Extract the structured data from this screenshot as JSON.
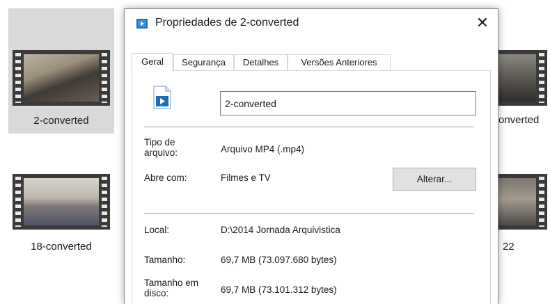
{
  "explorer": {
    "items": [
      {
        "label": "2-converted",
        "selected": true
      },
      {
        "label": "18-converted",
        "selected": false
      },
      {
        "label": "onverted",
        "selected": false
      },
      {
        "label": "22",
        "selected": false
      }
    ]
  },
  "dialog": {
    "title": "Propriedades de 2-converted",
    "close_label": "✕",
    "tabs": [
      {
        "label": "Geral",
        "active": true
      },
      {
        "label": "Segurança",
        "active": false
      },
      {
        "label": "Detalhes",
        "active": false
      },
      {
        "label": "Versões Anteriores",
        "active": false
      }
    ],
    "file_name": "2-converted",
    "fields": {
      "tipo_label": "Tipo de arquivo:",
      "tipo_value": "Arquivo MP4 (.mp4)",
      "abre_label": "Abre com:",
      "abre_value": "Filmes e TV",
      "alterar_label": "Alterar...",
      "local_label": "Local:",
      "local_value": "D:\\2014 Jornada Arquivistica",
      "tamanho_label": "Tamanho:",
      "tamanho_value": "69,7 MB (73.097.680 bytes)",
      "tamanho_disco_label": "Tamanho em disco:",
      "tamanho_disco_value": "69,7 MB (73.101.312 bytes)"
    }
  },
  "colors": {
    "accent_blue": "#1f6fb8",
    "selection_gray": "#d9d9d9",
    "button_gray": "#e1e1e1"
  }
}
